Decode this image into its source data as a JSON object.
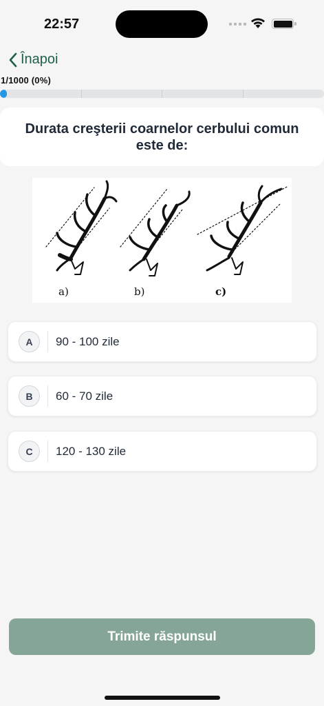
{
  "status_bar": {
    "time": "22:57"
  },
  "nav": {
    "back_label": "Înapoi"
  },
  "progress": {
    "label": "1/1000 (0%)",
    "current": 1,
    "total": 1000,
    "percent": 0
  },
  "question": {
    "text": "Durata creşterii coarnelor cerbului comun este de:"
  },
  "illustration": {
    "labels": [
      "a)",
      "b)",
      "c)"
    ]
  },
  "options": [
    {
      "letter": "A",
      "text": "90 - 100 zile"
    },
    {
      "letter": "B",
      "text": "60 - 70 zile"
    },
    {
      "letter": "C",
      "text": "120 - 130 zile"
    }
  ],
  "submit": {
    "label": "Trimite răspunsul"
  },
  "colors": {
    "accent": "#1f5f4a",
    "progress": "#2496e6",
    "submit": "#85a596",
    "background": "#f4f5f4"
  }
}
